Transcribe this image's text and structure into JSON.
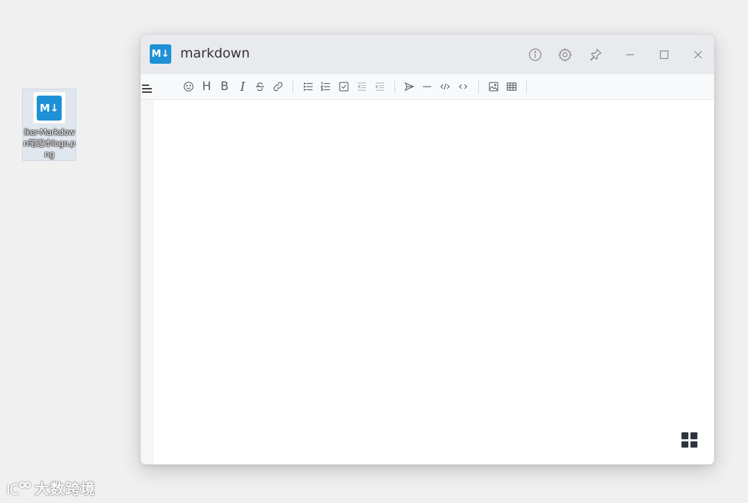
{
  "desktop": {
    "icon_label": "Iker-Markdown笔记本logo.png",
    "icon_logo_text": "M↓"
  },
  "window": {
    "logo_text": "M↓",
    "title": "markdown"
  },
  "titlebar_buttons": [
    "info-icon",
    "gear-icon",
    "pin-icon",
    "minimize-icon",
    "maximize-icon",
    "close-icon"
  ],
  "toolbar": {
    "heading_label": "H",
    "bold_label": "B",
    "italic_label": "I",
    "tools": [
      "emoji",
      "heading",
      "bold",
      "italic",
      "strike",
      "link",
      "list",
      "ordered-list",
      "check",
      "outdent",
      "indent",
      "quote",
      "line",
      "code",
      "inline-code",
      "upload",
      "table"
    ]
  },
  "watermark": {
    "text": "大数跨境"
  },
  "colors": {
    "accent": "#1e90d6",
    "titlebar": "#e8eaed",
    "toolbar": "#f8f9fa",
    "desktop": "#eff0ef"
  }
}
